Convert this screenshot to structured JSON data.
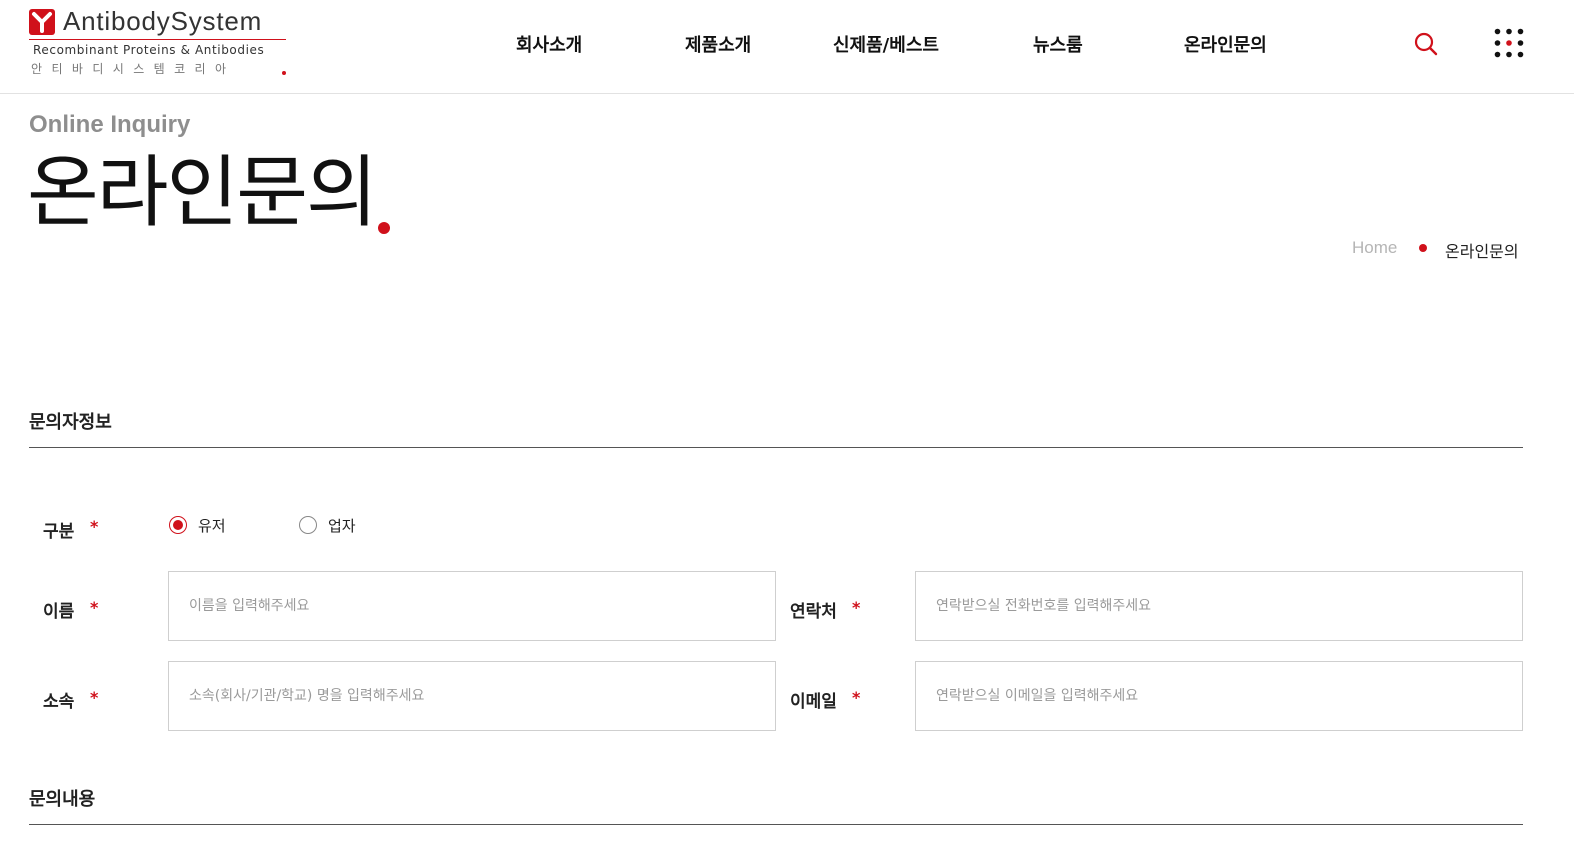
{
  "brand": {
    "name": "AntibodySystem",
    "subtitle": "Recombinant Proteins & Antibodies",
    "korean": "안티바디시스템코리아",
    "accent_color": "#d0111b"
  },
  "nav": {
    "items": [
      "회사소개",
      "제품소개",
      "신제품/베스트",
      "뉴스룸",
      "온라인문의"
    ],
    "search_icon": "search-icon",
    "menu_icon": "grid-menu-icon"
  },
  "page": {
    "eng_title": "Online Inquiry",
    "title": "온라인문의"
  },
  "breadcrumb": {
    "home": "Home",
    "current": "온라인문의"
  },
  "form": {
    "section1_title": "문의자정보",
    "section2_title": "문의내용",
    "required_mark": "*",
    "type": {
      "label": "구분",
      "options": [
        "유저",
        "업자"
      ],
      "selected": "유저"
    },
    "name": {
      "label": "이름",
      "placeholder": "이름을 입력해주세요",
      "value": ""
    },
    "phone": {
      "label": "연락처",
      "placeholder": "연락받으실 전화번호를 입력해주세요",
      "value": ""
    },
    "org": {
      "label": "소속",
      "placeholder": "소속(회사/기관/학교) 명을 입력해주세요",
      "value": ""
    },
    "email": {
      "label": "이메일",
      "placeholder": "연락받으실 이메일을 입력해주세요",
      "value": ""
    }
  }
}
